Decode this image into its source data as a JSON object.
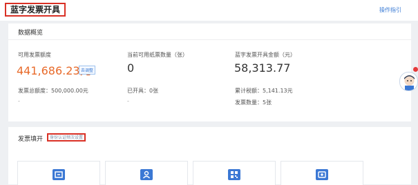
{
  "header": {
    "title": "蓝字发票开具",
    "guide_link": "操作指引"
  },
  "overview": {
    "section_title": "数据概览",
    "available_quota": {
      "label": "可用发票额度",
      "value": "441,686.23元",
      "button": "去调整"
    },
    "total_quota": "发票总额度：500,000.00元",
    "total_quota_sub": "-",
    "paper_invoices": {
      "label": "当前可用纸票数量（张）",
      "value": "0",
      "issued": "已开具：0张",
      "issued_sub": "-"
    },
    "blue_total": {
      "label": "蓝字发票开具金额（元）",
      "value": "58,313.77",
      "tax": "累计税额：5,141.13元",
      "count": "发票数量：5张"
    }
  },
  "issuance": {
    "section_title": "发票填开",
    "config_link": "身份认证频次设置"
  },
  "tiles": [
    {
      "icon": "invoice-ticket-icon"
    },
    {
      "icon": "user-card-icon"
    },
    {
      "icon": "qrcode-icon"
    },
    {
      "icon": "stamp-icon"
    }
  ],
  "colors": {
    "accent_orange": "#e86a2a",
    "link_blue": "#3a7bd5",
    "highlight_red": "#d93025",
    "tile_blue": "#3b78d4"
  }
}
